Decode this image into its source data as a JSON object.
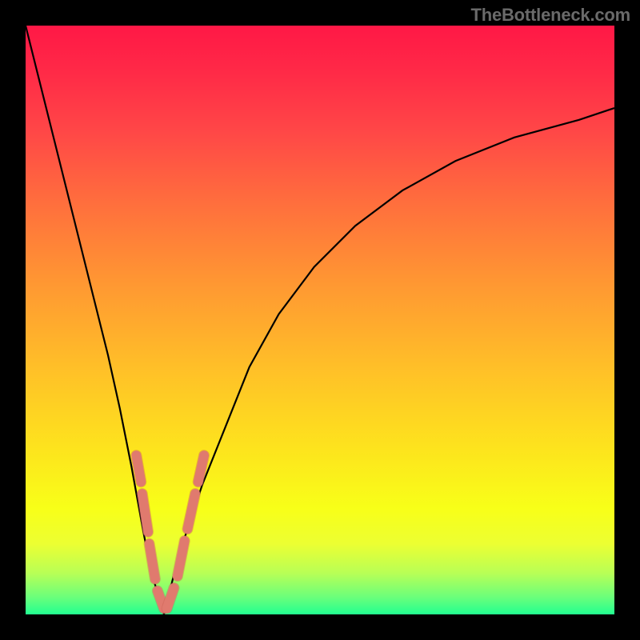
{
  "watermark": "TheBottleneck.com",
  "colors": {
    "background": "#000000",
    "curve_stroke": "#000000",
    "marker_fill": "#e07a6e",
    "marker_stroke": "#c85b50",
    "gradient_top": "#ff1846",
    "gradient_bottom": "#22ff90"
  },
  "chart_data": {
    "type": "line",
    "title": "",
    "xlabel": "",
    "ylabel": "",
    "xlim": [
      0,
      100
    ],
    "ylim": [
      0,
      100
    ],
    "series": [
      {
        "name": "left-branch",
        "x": [
          0,
          2,
          4,
          6,
          8,
          10,
          12,
          14,
          16,
          18,
          20,
          21,
          22,
          23,
          23.5
        ],
        "y": [
          100,
          92,
          84,
          76,
          68,
          60,
          52,
          44,
          35,
          25,
          14,
          9,
          5,
          2,
          0
        ]
      },
      {
        "name": "right-branch",
        "x": [
          23.5,
          25,
          27,
          30,
          34,
          38,
          43,
          49,
          56,
          64,
          73,
          83,
          94,
          100
        ],
        "y": [
          0,
          6,
          13,
          22,
          32,
          42,
          51,
          59,
          66,
          72,
          77,
          81,
          84,
          86
        ]
      }
    ],
    "markers": {
      "comment": "Salmon-colored short segments near the vertex, expressed as fractions of axis ranges",
      "segments": [
        {
          "x1": 18.8,
          "y1": 27.0,
          "x2": 19.6,
          "y2": 22.5
        },
        {
          "x1": 19.8,
          "y1": 20.5,
          "x2": 20.8,
          "y2": 14.0
        },
        {
          "x1": 21.0,
          "y1": 12.0,
          "x2": 22.0,
          "y2": 6.0
        },
        {
          "x1": 22.4,
          "y1": 4.0,
          "x2": 23.5,
          "y2": 1.0
        },
        {
          "x1": 24.0,
          "y1": 1.0,
          "x2": 25.2,
          "y2": 4.5
        },
        {
          "x1": 25.8,
          "y1": 6.5,
          "x2": 27.0,
          "y2": 12.5
        },
        {
          "x1": 27.5,
          "y1": 14.5,
          "x2": 28.8,
          "y2": 20.5
        },
        {
          "x1": 29.3,
          "y1": 22.5,
          "x2": 30.3,
          "y2": 27.0
        }
      ]
    }
  }
}
